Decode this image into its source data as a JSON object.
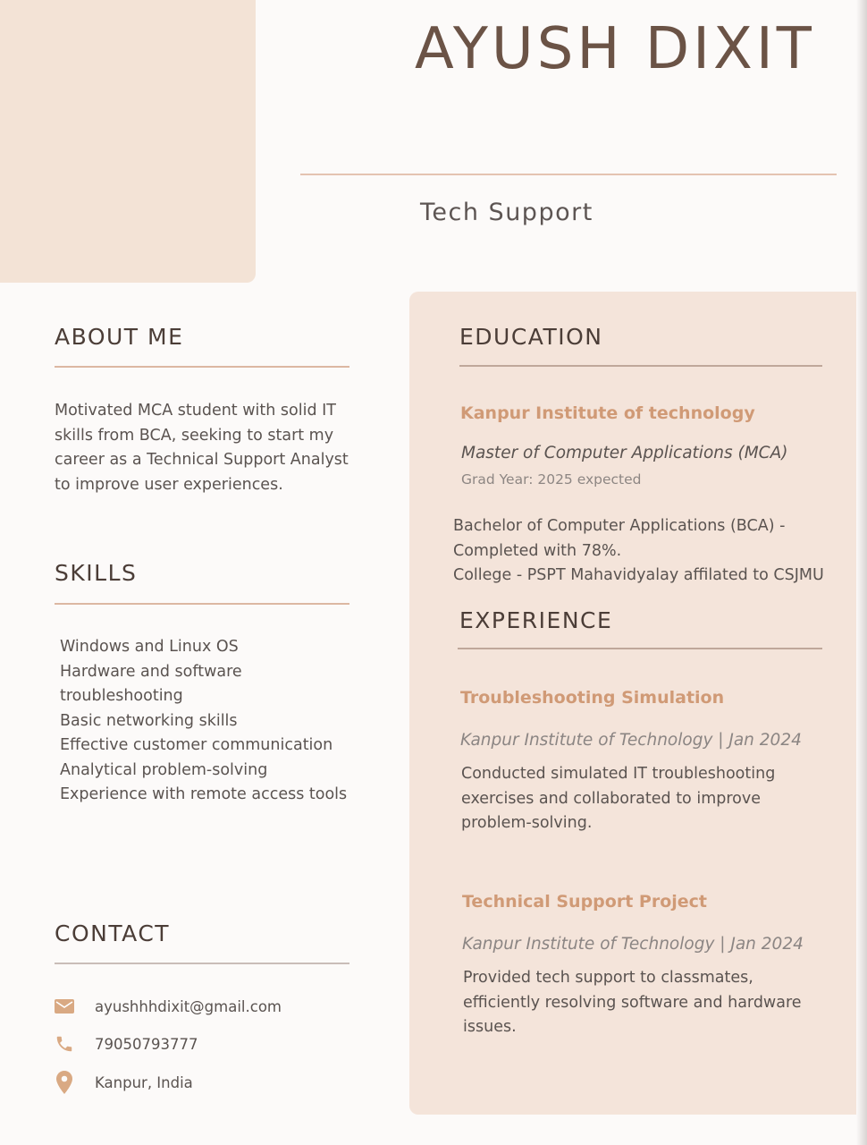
{
  "header": {
    "name": "AYUSH DIXIT",
    "job_title": "Tech Support"
  },
  "about": {
    "heading": "ABOUT ME",
    "lines": [
      "Motivated MCA student with solid IT",
      "skills from BCA, seeking to start my",
      "career as a Technical Support Analyst",
      "to improve user experiences."
    ]
  },
  "skills": {
    "heading": "SKILLS",
    "items": [
      "Windows and Linux OS",
      "Hardware and software",
      "troubleshooting",
      "Basic networking skills",
      "Effective customer communication",
      "Analytical problem-solving",
      "Experience with remote access tools"
    ]
  },
  "contact": {
    "heading": "CONTACT",
    "email": "ayushhhdixit@gmail.com",
    "phone": "79050793777",
    "location": "Kanpur, India",
    "icons": [
      "mail-icon",
      "phone-icon",
      "location-pin-icon"
    ]
  },
  "education": {
    "heading": "EDUCATION",
    "institution": "Kanpur Institute of technology",
    "degree": "Master of Computer Applications (MCA)",
    "grad_year": "Grad Year: 2025 expected",
    "bachelor_lines": [
      "Bachelor of Computer Applications (BCA) -",
      "Completed with 78%.",
      "College - PSPT Mahavidyalay affilated to CSJMU"
    ]
  },
  "experience": {
    "heading": "EXPERIENCE",
    "items": [
      {
        "title": "Troubleshooting Simulation",
        "org_date": "Kanpur Institute of Technology | Jan 2024",
        "lines": [
          "Conducted simulated IT troubleshooting",
          "exercises and collaborated to improve",
          "problem-solving."
        ]
      },
      {
        "title": "Technical Support Project",
        "org_date": "Kanpur Institute of Technology | Jan 2024",
        "lines": [
          "Provided tech support to classmates,",
          "efficiently resolving software and hardware",
          "issues."
        ]
      }
    ]
  },
  "colors": {
    "accent": "#d09a76",
    "panel": "#f4e4da",
    "photo_block": "#f3e3d6",
    "name": "#6b5346",
    "heading": "#4b3d37"
  }
}
